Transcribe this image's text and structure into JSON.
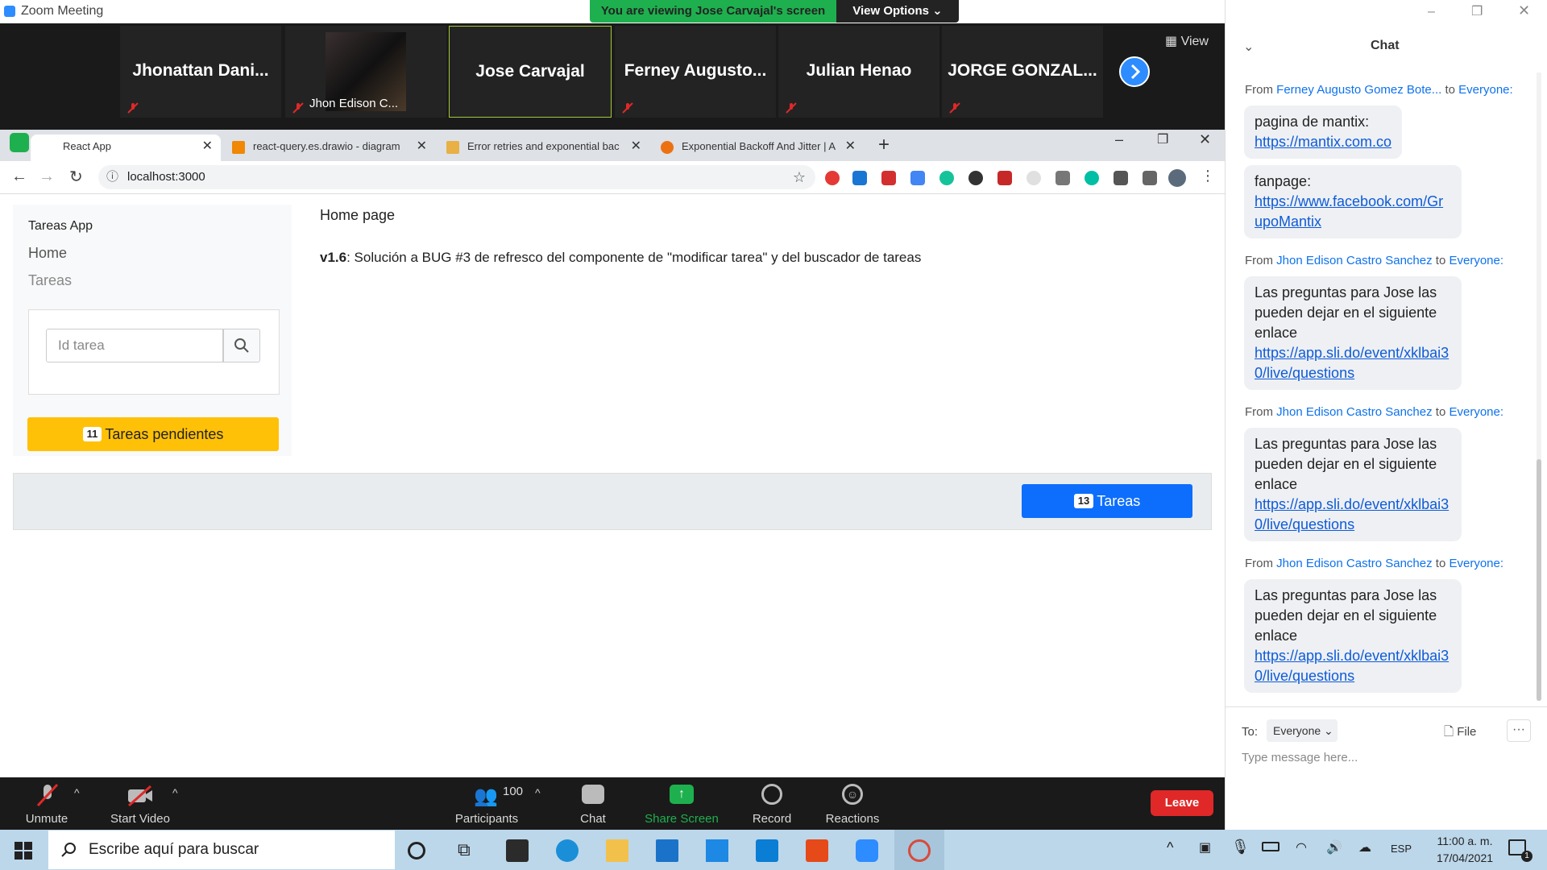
{
  "zoom": {
    "window_title": "Zoom Meeting",
    "viewing_banner": "You are viewing Jose Carvajal's screen",
    "view_options": "View Options",
    "view_label": "View",
    "participants": [
      {
        "name": "Jhonattan  Dani..."
      },
      {
        "name": "Jhon Edison C..."
      },
      {
        "name": "Jose Carvajal"
      },
      {
        "name": "Ferney  Augusto..."
      },
      {
        "name": "Julian Henao"
      },
      {
        "name": "JORGE  GONZAL..."
      }
    ],
    "toolbar": {
      "unmute": "Unmute",
      "start_video": "Start Video",
      "participants": "Participants",
      "participants_count": "100",
      "chat": "Chat",
      "share_screen": "Share Screen",
      "record": "Record",
      "reactions": "Reactions",
      "leave": "Leave"
    }
  },
  "browser": {
    "tabs": [
      {
        "title": "React App"
      },
      {
        "title": "react-query.es.drawio - diagram"
      },
      {
        "title": "Error retries and exponential bac"
      },
      {
        "title": "Exponential Backoff And Jitter | A"
      }
    ],
    "url": "localhost:3000"
  },
  "app": {
    "brand": "Tareas App",
    "nav": [
      "Home",
      "Tareas"
    ],
    "search_placeholder": "Id tarea",
    "pending_count": "11",
    "pending_label": "Tareas pendientes",
    "page_title": "Home page",
    "version": "v1.6",
    "version_note": ": Solución a BUG #3 de refresco del componente de \"modificar tarea\" y del buscador de tareas",
    "tareas_count": "13",
    "tareas_label": "Tareas"
  },
  "chat": {
    "title": "Chat",
    "messages": [
      {
        "from": "Ferney Augusto Gomez Bote...",
        "to": "Everyone:",
        "lines": [
          "pagina de mantix:"
        ],
        "link": "https://mantix.com.co"
      },
      {
        "lines": [
          "fanpage:"
        ],
        "link": "https://www.facebook.com/GrupoMantix"
      },
      {
        "from": "Jhon Edison Castro Sanchez",
        "to": "Everyone:",
        "lines": [
          "Las preguntas para Jose las pueden dejar en el siguiente enlace"
        ],
        "link": "https://app.sli.do/event/xklbai30/live/questions"
      },
      {
        "from": "Jhon Edison Castro Sanchez",
        "to": "Everyone:",
        "lines": [
          "Las preguntas para Jose las pueden dejar en el siguiente enlace"
        ],
        "link": "https://app.sli.do/event/xklbai30/live/questions"
      },
      {
        "from": "Jhon Edison Castro Sanchez",
        "to": "Everyone:",
        "lines": [
          "Las preguntas para Jose las pueden dejar en el siguiente enlace"
        ],
        "link": "https://app.sli.do/event/xklbai30/live/questions"
      }
    ],
    "from_label": "From",
    "to_label": "to",
    "to_prefix": "To:",
    "recipient": "Everyone",
    "file_label": "File",
    "input_placeholder": "Type message here..."
  },
  "taskbar": {
    "search_placeholder": "Escribe aquí para buscar",
    "lang": "ESP",
    "time": "11:00 a. m.",
    "date": "17/04/2021",
    "notifications": "1"
  }
}
